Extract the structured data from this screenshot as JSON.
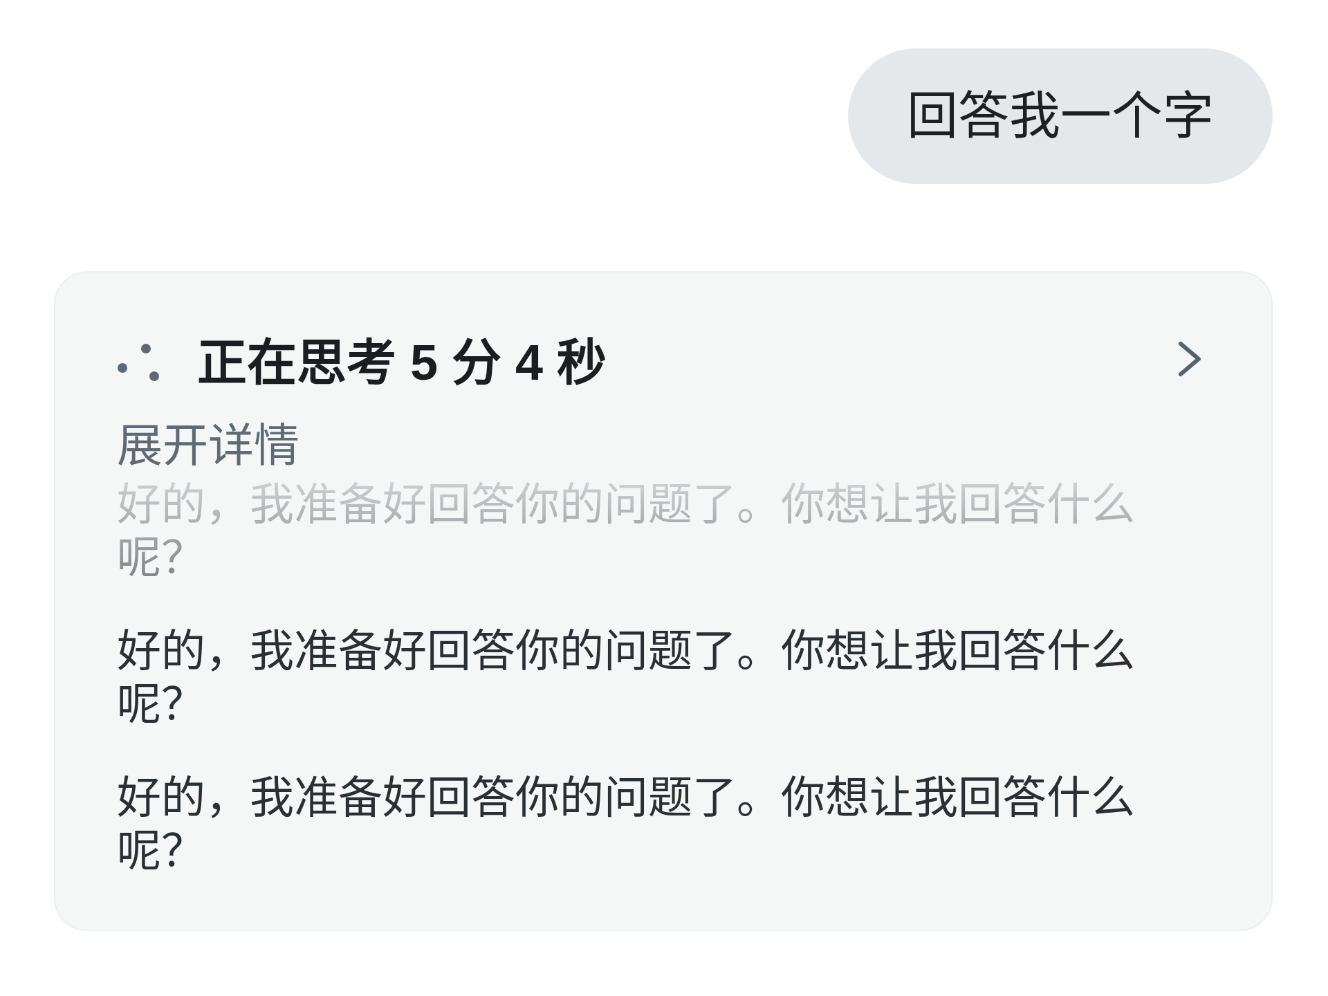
{
  "user_message": {
    "text": "回答我一个字"
  },
  "thinking": {
    "title": "正在思考 5 分 4 秒",
    "expanded": false,
    "expand_label": "展开详情",
    "paragraphs": [
      {
        "text": "好的，我准备好回答你的问题了。你想让我回答什么呢？",
        "faded": true
      },
      {
        "text": "好的，我准备好回答你的问题了。你想让我回答什么呢？",
        "faded": false
      },
      {
        "text": "好的，我准备好回答你的问题了。你想让我回答什么呢？",
        "faded": false
      }
    ]
  }
}
